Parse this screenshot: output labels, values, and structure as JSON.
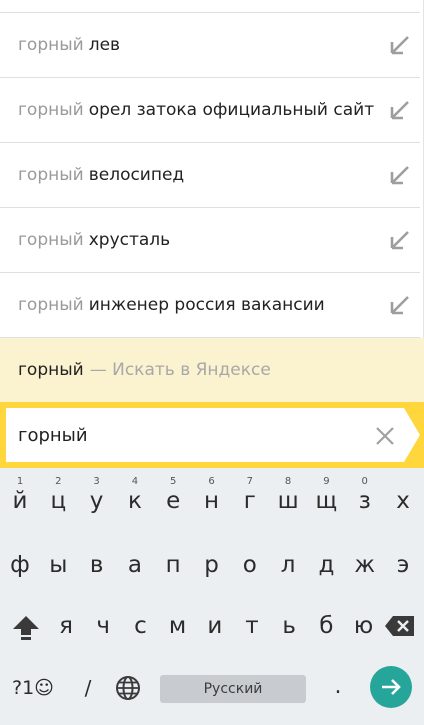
{
  "suggestions": {
    "query": "горный",
    "items": [
      {
        "completion": "лев"
      },
      {
        "completion": "орел затока официальный сайт"
      },
      {
        "completion": "велосипед"
      },
      {
        "completion": "хрусталь"
      },
      {
        "completion": "инженер россия вакансии"
      }
    ],
    "search_in": {
      "query": "горный",
      "label": "— Искать в Яндексе"
    }
  },
  "search": {
    "value": "горный"
  },
  "keyboard": {
    "row1": [
      {
        "ch": "й",
        "hint": "1"
      },
      {
        "ch": "ц",
        "hint": "2"
      },
      {
        "ch": "у",
        "hint": "3"
      },
      {
        "ch": "к",
        "hint": "4"
      },
      {
        "ch": "е",
        "hint": "5"
      },
      {
        "ch": "н",
        "hint": "6"
      },
      {
        "ch": "г",
        "hint": "7"
      },
      {
        "ch": "ш",
        "hint": "8"
      },
      {
        "ch": "щ",
        "hint": "9"
      },
      {
        "ch": "з",
        "hint": "0"
      },
      {
        "ch": "х",
        "hint": ""
      }
    ],
    "row2": [
      "ф",
      "ы",
      "в",
      "а",
      "п",
      "р",
      "о",
      "л",
      "д",
      "ж",
      "э"
    ],
    "row3": [
      "я",
      "ч",
      "с",
      "м",
      "и",
      "т",
      "ь",
      "б",
      "ю"
    ],
    "symbols_label": "?1☺",
    "slash": "/",
    "space_label": "Русский",
    "period": "."
  },
  "colors": {
    "accent": "#ffd63c",
    "enter": "#26a69a",
    "highlight": "#fbf2cf"
  }
}
